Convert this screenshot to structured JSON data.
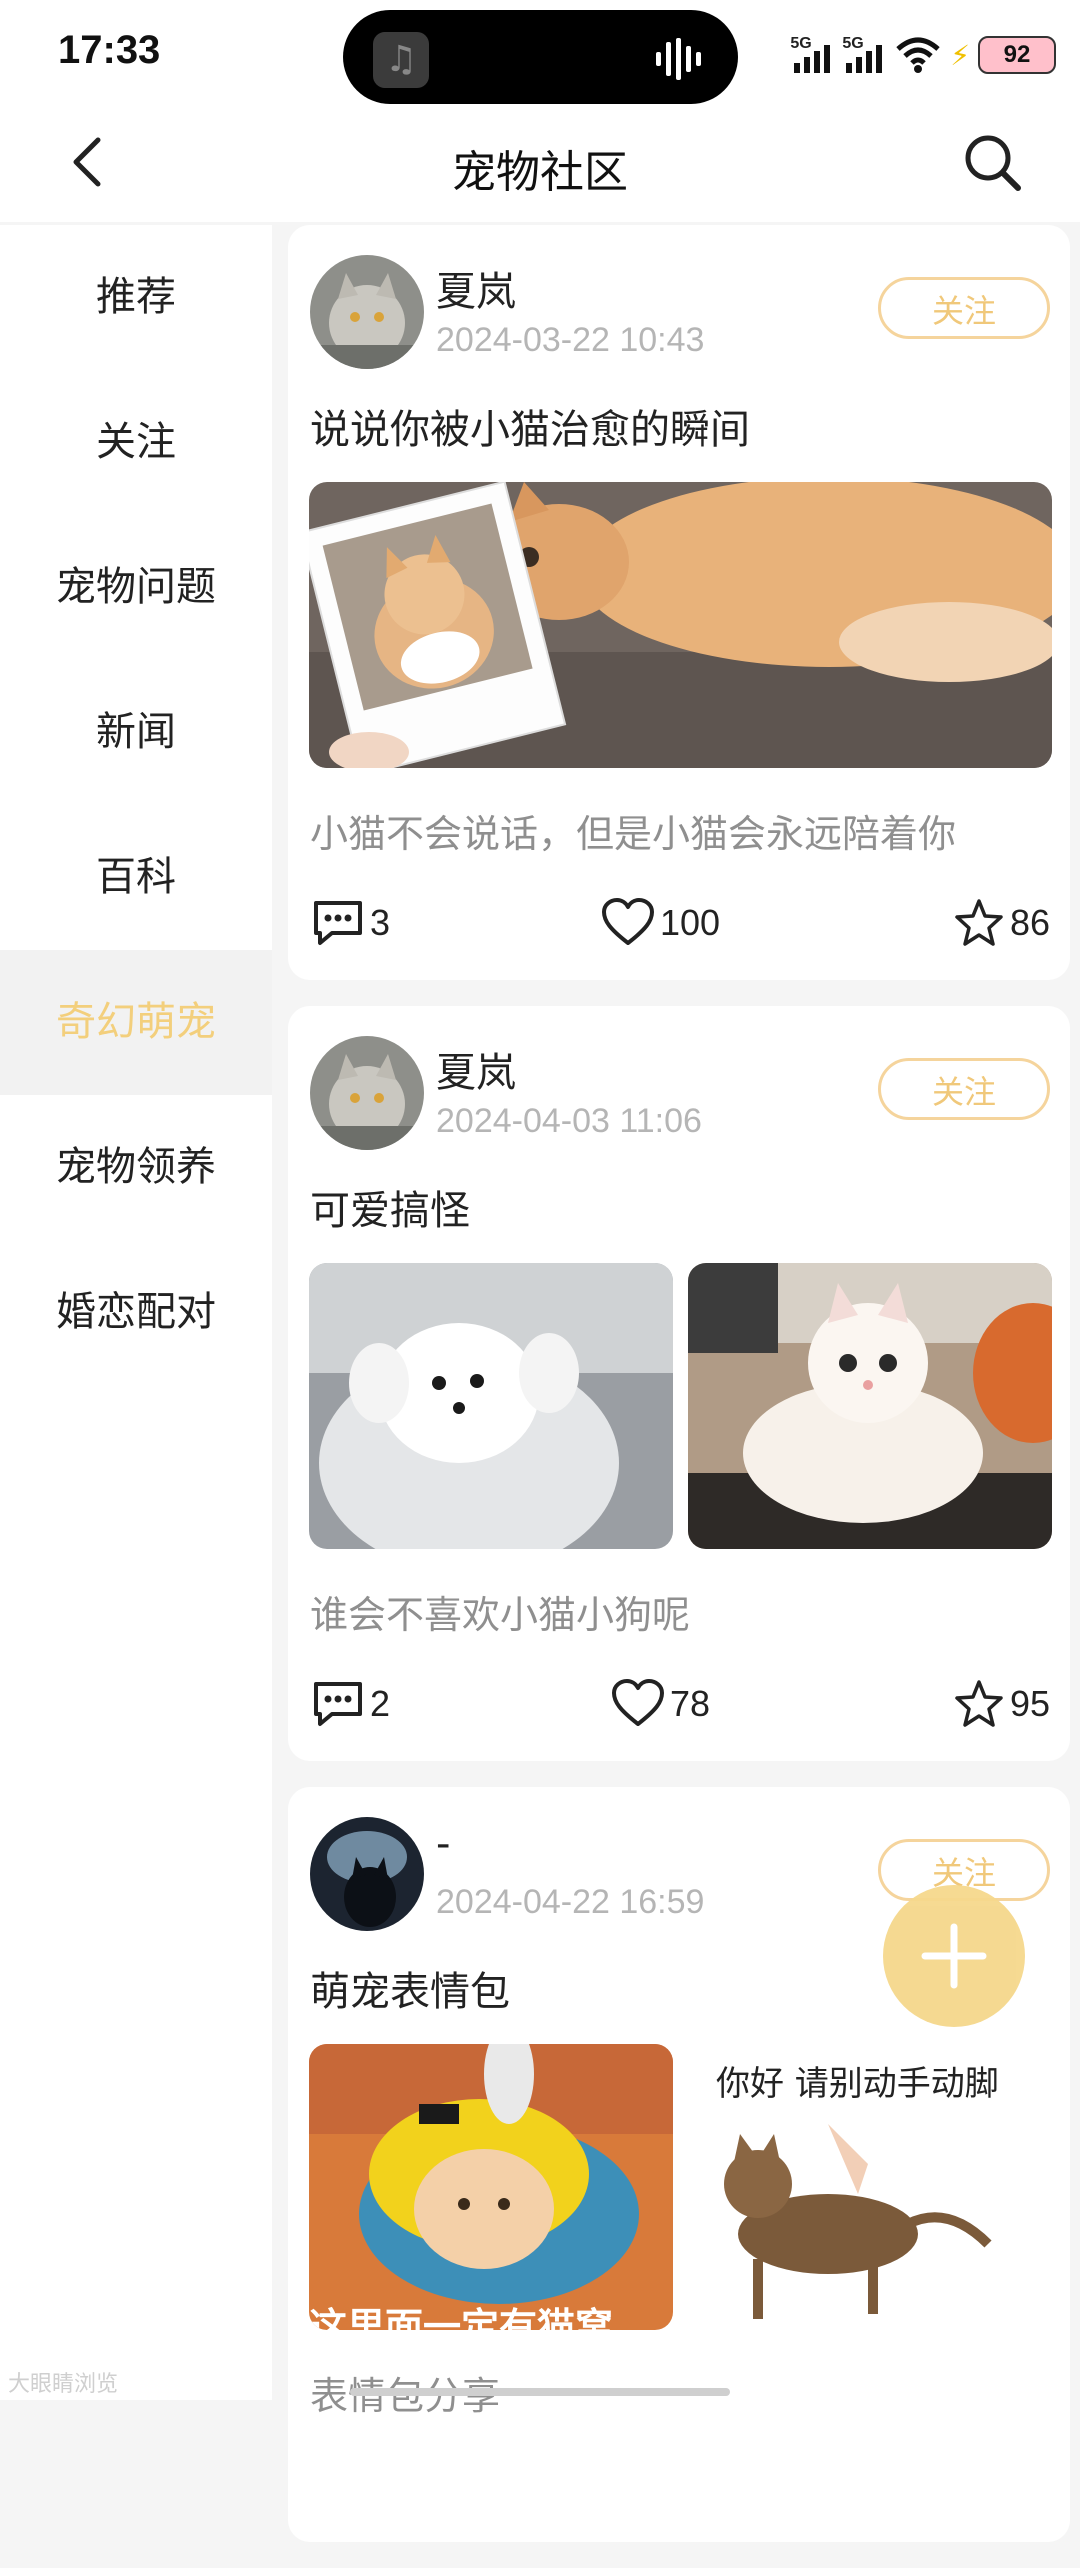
{
  "status_bar": {
    "time": "17:33",
    "network_1": "5G",
    "network_2": "5G",
    "battery": "92"
  },
  "header": {
    "title": "宠物社区",
    "back_icon": "chevron-left-icon",
    "search_icon": "search-icon"
  },
  "sidebar": {
    "items": [
      {
        "label": "推荐"
      },
      {
        "label": "关注"
      },
      {
        "label": "宠物问题"
      },
      {
        "label": "新闻"
      },
      {
        "label": "百科"
      },
      {
        "label": "奇幻萌宠",
        "active": true
      },
      {
        "label": "宠物领养"
      },
      {
        "label": "婚恋配对"
      }
    ],
    "active_color": "#f3cf7c"
  },
  "posts": [
    {
      "username": "夏岚",
      "timestamp": "2024-03-22 10:43",
      "follow_label": "关注",
      "title": "说说你被小猫治愈的瞬间",
      "caption": "小猫不会说话，但是小猫会永远陪着你",
      "comments": "3",
      "likes": "100",
      "favorites": "86"
    },
    {
      "username": "夏岚",
      "timestamp": "2024-04-03 11:06",
      "follow_label": "关注",
      "title": "可爱搞怪",
      "caption": "谁会不喜欢小猫小狗呢",
      "comments": "2",
      "likes": "78",
      "favorites": "95"
    },
    {
      "username": "-",
      "timestamp": "2024-04-22 16:59",
      "follow_label": "关注",
      "title": "萌宠表情包",
      "caption": "表情包分享",
      "image_text_1": "这里面一定有猫窝",
      "image_text_2": "你好 请别动手动脚"
    }
  ],
  "fab": {
    "icon": "plus-icon"
  },
  "watermark": "大眼睛浏览",
  "colors": {
    "accent": "#f3cf7c",
    "follow_border": "#f5d49c",
    "fab": "#f5d88c",
    "muted_text": "#8f8f8f"
  }
}
